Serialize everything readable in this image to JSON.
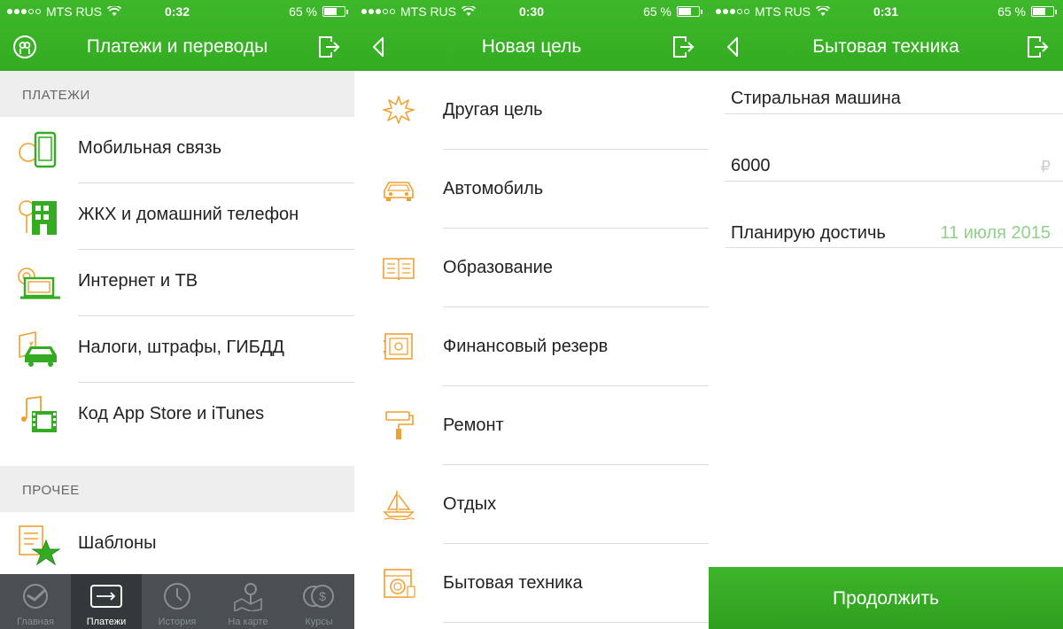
{
  "status": {
    "carrier": "MTS RUS",
    "battery": "65 %",
    "battery_level": 0.65,
    "times": [
      "0:32",
      "0:30",
      "0:31"
    ]
  },
  "colors": {
    "green": "#34ac22",
    "orange": "#f0a030",
    "tabbar": "#4a5052"
  },
  "screen1": {
    "title": "Платежи и переводы",
    "payments_header": "ПЛАТЕЖИ",
    "payments": [
      {
        "label": "Мобильная связь",
        "icon": "mobile-phone-icon"
      },
      {
        "label": "ЖКХ и домашний телефон",
        "icon": "building-icon"
      },
      {
        "label": "Интернет и ТВ",
        "icon": "laptop-icon"
      },
      {
        "label": "Налоги, штрафы, ГИБДД",
        "icon": "car-fine-icon"
      },
      {
        "label": "Код App Store и iTunes",
        "icon": "music-film-icon"
      }
    ],
    "other_header": "ПРОЧЕЕ",
    "other": [
      {
        "label": "Шаблоны",
        "icon": "star-document-icon"
      }
    ],
    "tabs": [
      {
        "label": "Главная",
        "icon": "sber-logo-icon",
        "active": false
      },
      {
        "label": "Платежи",
        "icon": "card-icon",
        "active": true
      },
      {
        "label": "История",
        "icon": "clock-icon",
        "active": false
      },
      {
        "label": "На карте",
        "icon": "map-pin-icon",
        "active": false
      },
      {
        "label": "Курсы",
        "icon": "coins-icon",
        "active": false
      }
    ]
  },
  "screen2": {
    "title": "Новая цель",
    "goals": [
      {
        "label": "Другая цель",
        "icon": "starburst-icon"
      },
      {
        "label": "Автомобиль",
        "icon": "car-icon"
      },
      {
        "label": "Образование",
        "icon": "book-icon"
      },
      {
        "label": "Финансовый резерв",
        "icon": "safe-icon"
      },
      {
        "label": "Ремонт",
        "icon": "paint-roller-icon"
      },
      {
        "label": "Отдых",
        "icon": "sailboat-icon"
      },
      {
        "label": "Бытовая техника",
        "icon": "washing-machine-icon"
      }
    ]
  },
  "screen3": {
    "title": "Бытовая техника",
    "goal_name": "Стиральная машина",
    "amount": "6000",
    "currency": "₽",
    "plan_label": "Планирую достичь",
    "plan_date": "11 июля 2015",
    "continue_label": "Продолжить"
  }
}
